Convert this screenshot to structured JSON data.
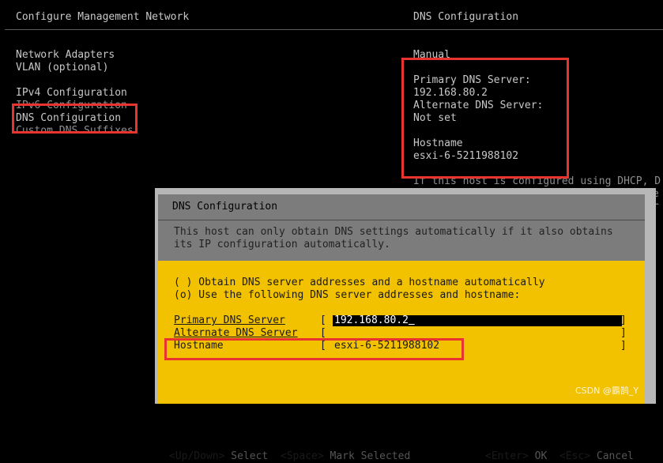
{
  "header": {
    "left_title": "Configure Management Network",
    "right_title": "DNS Configuration"
  },
  "menu": {
    "items": [
      {
        "label": "Network Adapters"
      },
      {
        "label": "VLAN (optional)"
      },
      {
        "label": "IPv4 Configuration"
      },
      {
        "label": "IPv6 Configuration"
      },
      {
        "label": "DNS Configuration"
      },
      {
        "label": "Custom DNS Suffixes"
      }
    ]
  },
  "info": {
    "mode": "Manual",
    "primary_label": "Primary DNS Server:",
    "primary_value": "192.168.80.2",
    "alternate_label": "Alternate DNS Server:",
    "alternate_value": "Not set",
    "hostname_label": "Hostname",
    "hostname_value": "esxi-6-5211988102",
    "dhcp_note": "If this host is configured using DHCP, D",
    "cut1": "ne",
    "cut2": "or"
  },
  "dialog": {
    "title": "DNS Configuration",
    "description_line1": "This host can only obtain DNS settings automatically if it also obtains",
    "description_line2": "its IP configuration automatically.",
    "option_auto": "( ) Obtain DNS server addresses and a hostname automatically",
    "option_manual": "(o) Use the following DNS server addresses and hostname:",
    "fields": {
      "primary_label": "Primary DNS Server",
      "primary_value": "192.168.80.2",
      "alternate_label": "Alternate DNS Server",
      "alternate_value": "",
      "hostname_label": "Hostname",
      "hostname_value": "esxi-6-5211988102"
    },
    "footer": {
      "updown_key": "<Up/Down>",
      "updown_action": "Select",
      "space_key": "<Space>",
      "space_action": "Mark Selected",
      "enter_key": "<Enter>",
      "enter_action": "OK",
      "esc_key": "<Esc>",
      "esc_action": "Cancel"
    }
  },
  "watermark": "CSDN @霸鹄_Y",
  "colors": {
    "highlight": "#e8332e",
    "dialog_body": "#f2c100",
    "dialog_frame": "#b7b7b7",
    "dialog_header": "#7c7c7c"
  }
}
